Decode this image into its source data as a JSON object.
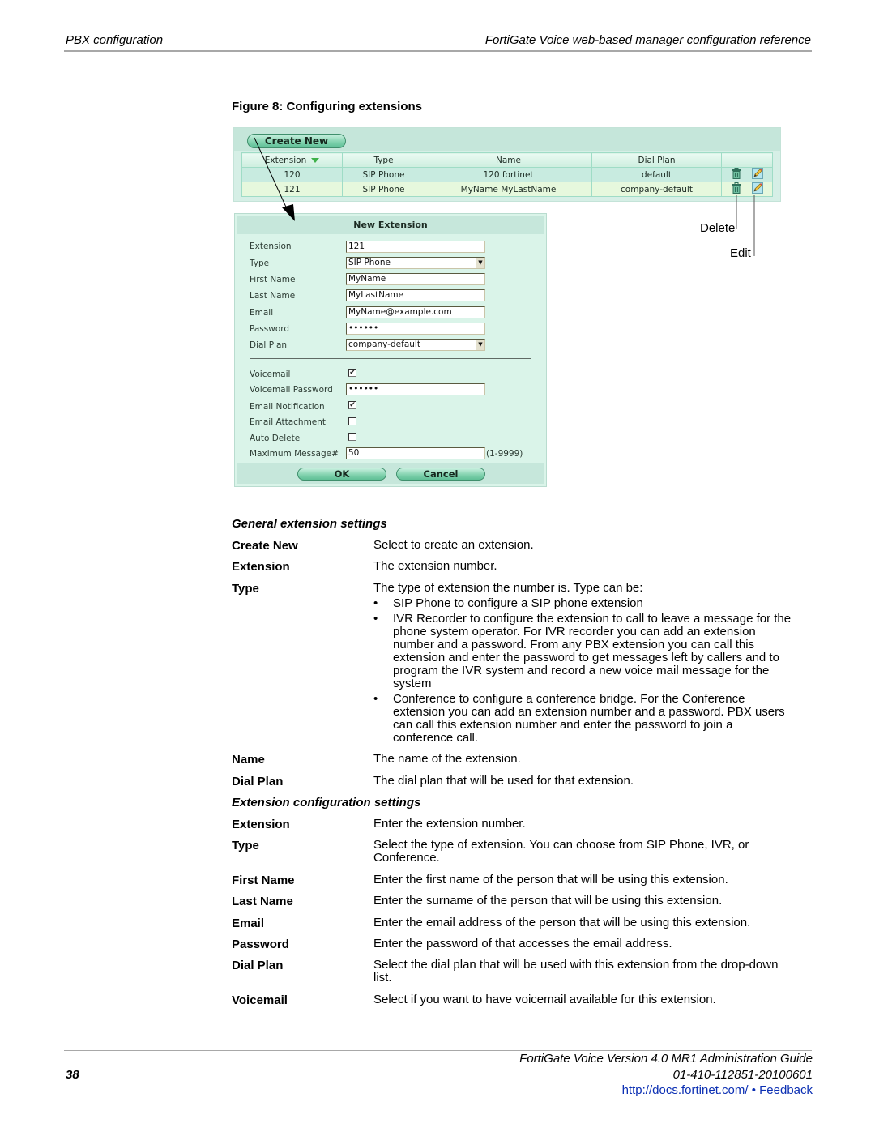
{
  "header": {
    "section": "PBX configuration",
    "chapter": "FortiGate Voice web-based manager configuration reference"
  },
  "figure": {
    "title": "Figure 8: Configuring extensions"
  },
  "extension_list": {
    "create_new_label": "Create New",
    "columns": [
      "Extension",
      "Type",
      "Name",
      "Dial Plan",
      ""
    ],
    "rows": [
      {
        "extension": "120",
        "type": "SIP Phone",
        "name": "120 fortinet",
        "dial_plan": "default"
      },
      {
        "extension": "121",
        "type": "SIP Phone",
        "name": "MyName MyLastName",
        "dial_plan": "company-default"
      }
    ],
    "icons": {
      "sort": "sort-descending-icon",
      "delete": "trash-icon",
      "edit": "pencil-icon"
    }
  },
  "new_extension_dialog": {
    "title": "New Extension",
    "fields": {
      "extension": {
        "label": "Extension",
        "value": "121"
      },
      "type": {
        "label": "Type",
        "value": "SIP Phone"
      },
      "first_name": {
        "label": "First Name",
        "value": "MyName"
      },
      "last_name": {
        "label": "Last Name",
        "value": "MyLastName"
      },
      "email": {
        "label": "Email",
        "value": "MyName@example.com"
      },
      "password": {
        "label": "Password",
        "value": "••••••"
      },
      "dial_plan": {
        "label": "Dial Plan",
        "value": "company-default"
      },
      "voicemail": {
        "label": "Voicemail",
        "checked": true
      },
      "voicemail_password": {
        "label": "Voicemail Password",
        "value": "••••••"
      },
      "email_notification": {
        "label": "Email Notification",
        "checked": true
      },
      "email_attachment": {
        "label": "Email Attachment",
        "checked": false
      },
      "auto_delete": {
        "label": "Auto Delete",
        "checked": false
      },
      "maximum_message": {
        "label": "Maximum Message#",
        "value": "50",
        "hint": "(1-9999)"
      }
    },
    "ok_label": "OK",
    "cancel_label": "Cancel"
  },
  "callouts": {
    "delete": "Delete",
    "edit": "Edit"
  },
  "general_settings": {
    "title": "General extension settings",
    "items": [
      {
        "term": "Create New",
        "desc": "Select to create an extension."
      },
      {
        "term": "Extension",
        "desc": "The extension number."
      },
      {
        "term": "Type",
        "desc": "The type of extension the number is. Type can be:",
        "bullets": [
          "SIP Phone to configure a SIP phone extension",
          "IVR Recorder to configure the extension to call to leave a message for the phone system operator. For IVR recorder you can add an extension number and a password. From any PBX extension you can call this extension and enter the password to get messages left by callers and to program the IVR system and record a new voice mail message for the system",
          "Conference to configure a conference bridge. For the Conference extension you can add an extension number and a password. PBX users can call this extension number and enter the password to join a conference call."
        ]
      },
      {
        "term": "Name",
        "desc": "The name of the extension."
      },
      {
        "term": "Dial Plan",
        "desc": "The dial plan that will be used for that extension."
      }
    ]
  },
  "config_settings": {
    "title": "Extension configuration settings",
    "items": [
      {
        "term": "Extension",
        "desc": "Enter the extension number."
      },
      {
        "term": "Type",
        "desc": "Select the type of extension. You can choose from SIP Phone, IVR, or Conference."
      },
      {
        "term": "First Name",
        "desc": "Enter the first name of the person that will be using this extension."
      },
      {
        "term": "Last Name",
        "desc": "Enter the surname of the person that will be using this extension."
      },
      {
        "term": "Email",
        "desc": "Enter the email address of the person that will be using this extension."
      },
      {
        "term": "Password",
        "desc": "Enter the password of that accesses the email address."
      },
      {
        "term": "Dial Plan",
        "desc": "Select the dial plan that will be used with this extension from the drop-down list."
      },
      {
        "term": "Voicemail",
        "desc": "Select if you want to have voicemail available for this extension."
      }
    ]
  },
  "footer": {
    "guide_title": "FortiGate Voice Version 4.0 MR1 Administration Guide",
    "page_number": "38",
    "doc_number": "01-410-112851-20100601",
    "docs_link": "http://docs.fortinet.com/",
    "separator": " • ",
    "feedback_link": "Feedback"
  }
}
